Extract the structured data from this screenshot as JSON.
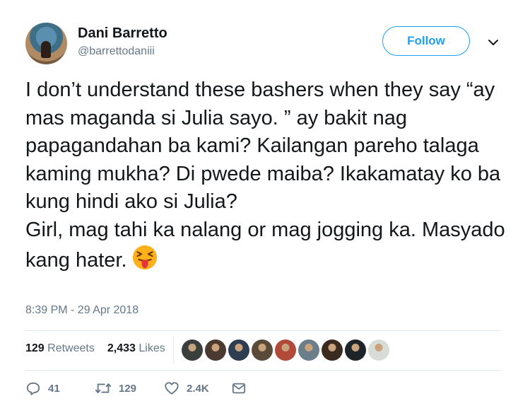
{
  "author": {
    "name": "Dani Barretto",
    "handle": "@barrettodaniii"
  },
  "follow_label": "Follow",
  "tweet": {
    "text": "I don’t understand these bashers when they say “ay mas maganda si Julia sayo. ” ay bakit nag papagandahan ba kami? Kailangan pareho talaga kaming mukha? Di pwede maiba? Ikakamatay ko ba kung hindi ako si Julia?\nGirl, mag tahi ka nalang or mag jogging ka. Masyado kang hater.",
    "emoji": "squinting-face-with-tongue-icon",
    "timestamp": "8:39 PM - 29 Apr 2018"
  },
  "stats": {
    "retweets_count": "129",
    "retweets_label": "Retweets",
    "likes_count": "2,433",
    "likes_label": "Likes"
  },
  "liker_avatars": [
    "#3a3f3c",
    "#4a3a30",
    "#2c3e50",
    "#5a4a3a",
    "#b24a3a",
    "#6b7f8a",
    "#3b2a20",
    "#1f2429",
    "#d8dcd6"
  ],
  "actions": {
    "replies": "41",
    "retweets": "129",
    "likes": "2.4K"
  },
  "colors": {
    "accent": "#1da1f2",
    "muted": "#657786",
    "text": "#14171a"
  }
}
